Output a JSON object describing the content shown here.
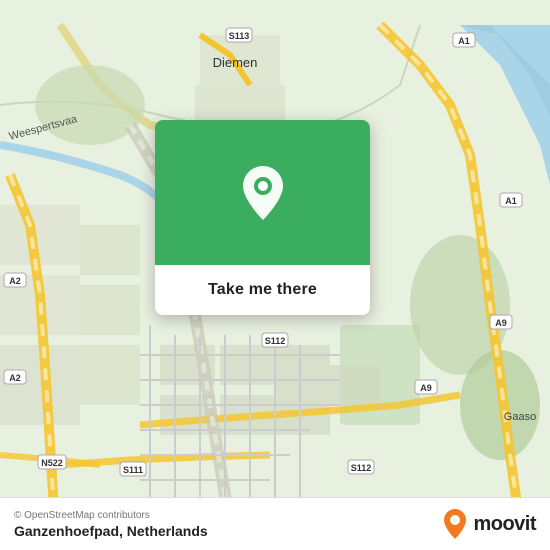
{
  "map": {
    "attribution": "© OpenStreetMap contributors",
    "location_name": "Ganzenhoefpad, Netherlands",
    "center_lat": 52.32,
    "center_lng": 4.96
  },
  "card": {
    "button_label": "Take me there",
    "pin_color": "#3aad5e"
  },
  "branding": {
    "name": "moovit",
    "logo_alt": "Moovit logo"
  },
  "road_badges": [
    "S113",
    "A1",
    "A9",
    "S112",
    "S111",
    "S112",
    "N522",
    "A2",
    "A9"
  ],
  "place_labels": [
    "Diemen",
    "Gaaso"
  ]
}
